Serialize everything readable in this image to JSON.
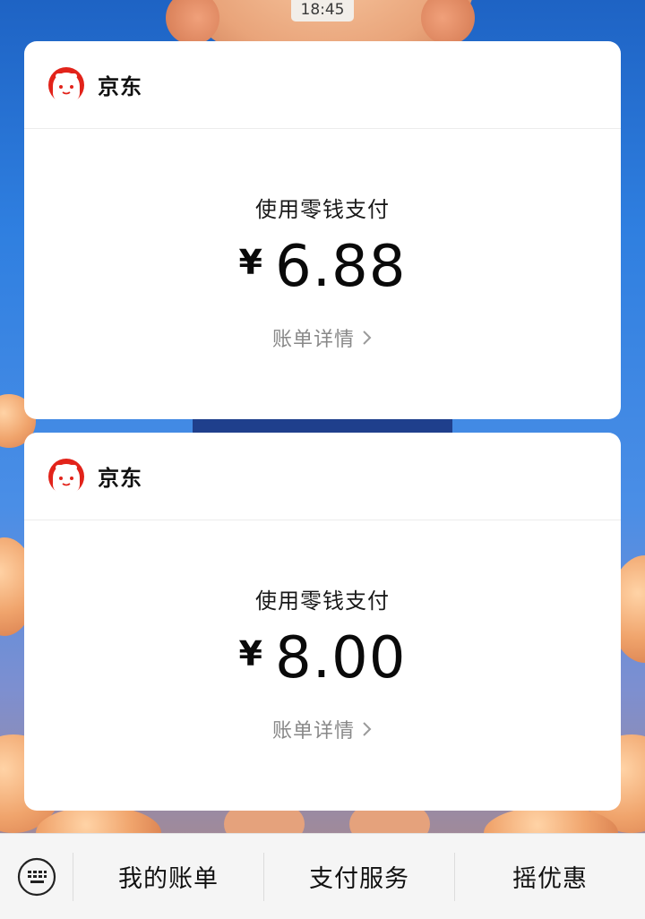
{
  "status": {
    "time": "18:45"
  },
  "messages": [
    {
      "merchant": "京东",
      "pay_method": "使用零钱支付",
      "currency": "¥",
      "amount": "6.88",
      "detail_label": "账单详情"
    },
    {
      "merchant": "京东",
      "pay_method": "使用零钱支付",
      "currency": "¥",
      "amount": "8.00",
      "detail_label": "账单详情"
    }
  ],
  "bottom_menu": {
    "keyboard_icon": "keyboard-icon",
    "items": [
      "我的账单",
      "支付服务",
      "摇优惠"
    ]
  },
  "colors": {
    "jd_red": "#e2231a",
    "card_bg": "#ffffff",
    "menu_bg": "#f5f5f5"
  }
}
